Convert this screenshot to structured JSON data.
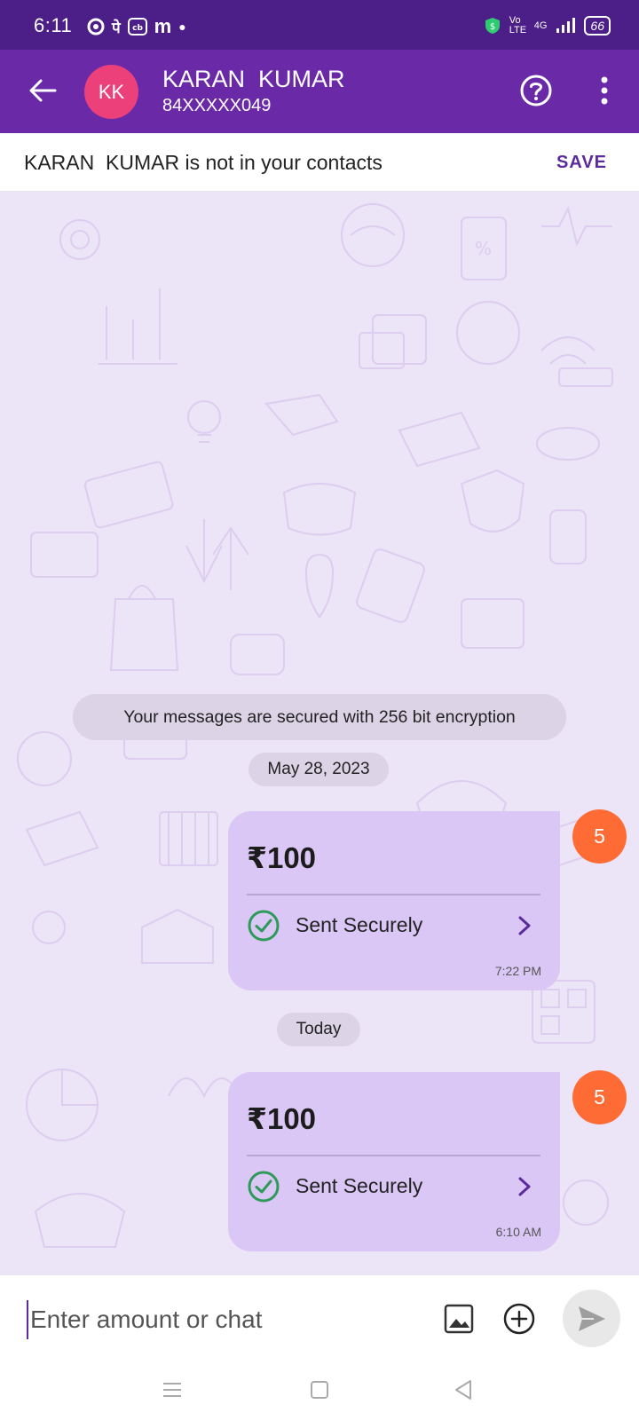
{
  "status_bar": {
    "time": "6:11",
    "left_icons": [
      "sync-icon",
      "pe-icon",
      "cb-icon",
      "m-icon",
      "dot-icon"
    ],
    "network": "4G",
    "volte": "Vo LTE",
    "battery": "66"
  },
  "header": {
    "avatar_initials": "KK",
    "name": "KARAN  KUMAR",
    "phone": "84XXXXX049"
  },
  "contact_banner": {
    "text": "KARAN  KUMAR is not in your contacts",
    "save_label": "SAVE"
  },
  "chat": {
    "encryption_notice": "Your messages are secured with 256 bit encryption",
    "messages": [
      {
        "date_label": "May 28, 2023",
        "amount": "₹100",
        "status": "Sent Securely",
        "time": "7:22 PM",
        "badge": "5"
      },
      {
        "date_label": "Today",
        "amount": "₹100",
        "status": "Sent Securely",
        "time": "6:10 AM",
        "badge": "5"
      }
    ]
  },
  "input": {
    "placeholder": "Enter amount or chat"
  },
  "colors": {
    "header": "#6a2aa8",
    "status_bar": "#4b1f87",
    "bubble": "#dac7f5",
    "badge": "#ff6b35",
    "avatar": "#ec407a",
    "success": "#2e9a5a"
  }
}
